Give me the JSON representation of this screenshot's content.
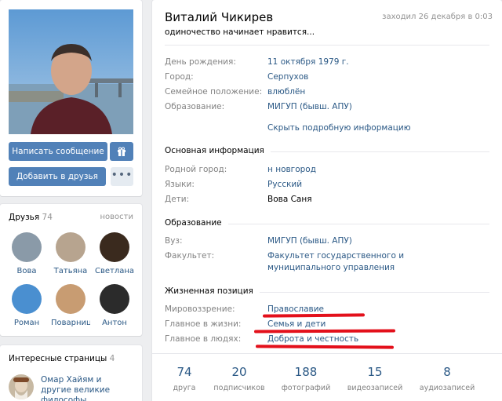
{
  "profile": {
    "name": "Виталий Чикирев",
    "status": "одиночество начинает нравится...",
    "last_seen": "заходил 26 декабря в 0:03",
    "buttons": {
      "message": "Написать сообщение",
      "add_friend": "Добавить в друзья",
      "more": "•••"
    }
  },
  "info": {
    "birthday": {
      "label": "День рождения:",
      "value": "11 октября 1979 г."
    },
    "city": {
      "label": "Город:",
      "value": "Серпухов"
    },
    "relationship": {
      "label": "Семейное положение:",
      "value": "влюблён"
    },
    "education": {
      "label": "Образование:",
      "value": "МИГУП (бывш. АПУ)"
    },
    "hide_details": "Скрыть подробную информацию"
  },
  "main_info": {
    "title": "Основная информация",
    "hometown": {
      "label": "Родной город:",
      "value": "н новгород"
    },
    "languages": {
      "label": "Языки:",
      "value": "Русский"
    },
    "children": {
      "label": "Дети:",
      "value": "Вова Саня"
    }
  },
  "education_section": {
    "title": "Образование",
    "university": {
      "label": "Вуз:",
      "value": "МИГУП (бывш. АПУ)"
    },
    "faculty": {
      "label": "Факультет:",
      "value": "Факультет государственного и муниципального управления"
    }
  },
  "life_position": {
    "title": "Жизненная позиция",
    "worldview": {
      "label": "Мировоззрение:",
      "value": "Православие"
    },
    "life_main": {
      "label": "Главное в жизни:",
      "value": "Семья и дети"
    },
    "people_main": {
      "label": "Главное в людях:",
      "value": "Доброта и честность"
    }
  },
  "counters": [
    {
      "value": "74",
      "label": "друга"
    },
    {
      "value": "20",
      "label": "подписчиков"
    },
    {
      "value": "188",
      "label": "фотографий"
    },
    {
      "value": "15",
      "label": "видеозаписей"
    },
    {
      "value": "8",
      "label": "аудиозаписей"
    }
  ],
  "friends": {
    "title": "Друзья",
    "count": "74",
    "news_link": "новости",
    "list": [
      {
        "name": "Вова",
        "color": "#8a9aa8"
      },
      {
        "name": "Татьяна",
        "color": "#b7a48f"
      },
      {
        "name": "Светлана",
        "color": "#3a2a1e"
      },
      {
        "name": "Роман",
        "color": "#4a8fd0"
      },
      {
        "name": "Поварниц...",
        "color": "#c89c72"
      },
      {
        "name": "Антон",
        "color": "#2b2b2b"
      }
    ]
  },
  "interesting_pages": {
    "title": "Интересные страницы",
    "count": "4",
    "first_page": "Омар Хайям и другие великие философы"
  },
  "colors": {
    "accent": "#5181b8",
    "link": "#2a5885",
    "annotation": "#e3101b"
  }
}
